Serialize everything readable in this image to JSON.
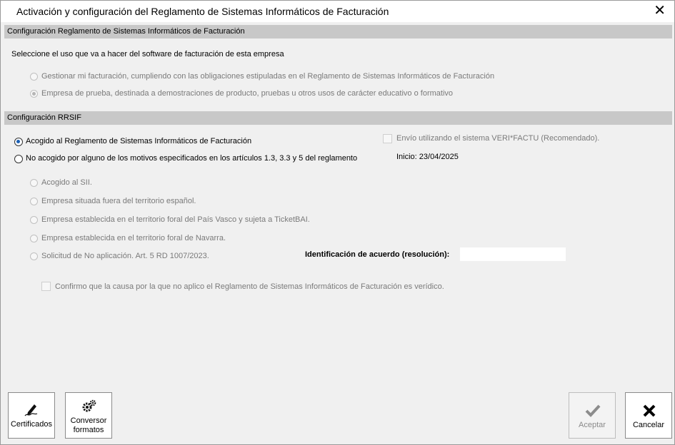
{
  "window": {
    "title": "Activación y configuración del Reglamento de Sistemas Informáticos de Facturación",
    "close_glyph": "✕"
  },
  "section1": {
    "header": "Configuración Reglamento de Sistemas Informáticos de Facturación",
    "prompt": "Seleccione el uso que va a hacer del software de facturación de esta empresa",
    "options": [
      {
        "label": "Gestionar mi facturación, cumpliendo con las obligaciones estipuladas en el Reglamento de Sistemas Informáticos de Facturación",
        "selected": false,
        "enabled": false
      },
      {
        "label": "Empresa de prueba, destinada a demostraciones de producto, pruebas u otros usos de carácter educativo o formativo",
        "selected": true,
        "enabled": false
      }
    ]
  },
  "section2": {
    "header": "Configuración RRSIF",
    "main_options": [
      {
        "label": "Acogido al Reglamento de Sistemas Informáticos de Facturación",
        "selected": true
      },
      {
        "label": "No acogido por alguno de los motivos especificados en los artículos 1.3, 3.3 y 5 del reglamento",
        "selected": false
      }
    ],
    "verifactu_checkbox": {
      "label": "Envío utilizando el sistema VERI*FACTU (Recomendado).",
      "checked": false,
      "enabled": false
    },
    "start_date": "Inicio: 23/04/2025",
    "reasons": [
      {
        "label": "Acogido al SII."
      },
      {
        "label": "Empresa situada fuera del territorio español."
      },
      {
        "label": "Empresa establecida en el territorio foral del País Vasco y sujeta a TicketBAI."
      },
      {
        "label": "Empresa establecida en el territorio foral de Navarra."
      },
      {
        "label": "Solicitud de No aplicación. Art. 5 RD 1007/2023."
      }
    ],
    "agreement_label": "Identificación de acuerdo (resolución):",
    "agreement_value": "",
    "confirm_checkbox": {
      "label": "Confirmo que la causa por la que no aplico el Reglamento de Sistemas Informáticos de Facturación es verídico.",
      "checked": false,
      "enabled": false
    }
  },
  "buttons": {
    "certificados": {
      "label": "Certificados",
      "icon": "signature-pen-icon"
    },
    "conversor": {
      "label_line1": "Conversor",
      "label_line2": "formatos",
      "icon": "gears-icon"
    },
    "aceptar": {
      "label": "Aceptar",
      "icon": "checkmark-icon",
      "enabled": false
    },
    "cancelar": {
      "label": "Cancelar",
      "icon": "x-mark-icon"
    }
  },
  "colors": {
    "section_bar": "#c8c8c8",
    "radio_selected": "#1a5fb4",
    "disabled_text": "#7a7a7a"
  }
}
